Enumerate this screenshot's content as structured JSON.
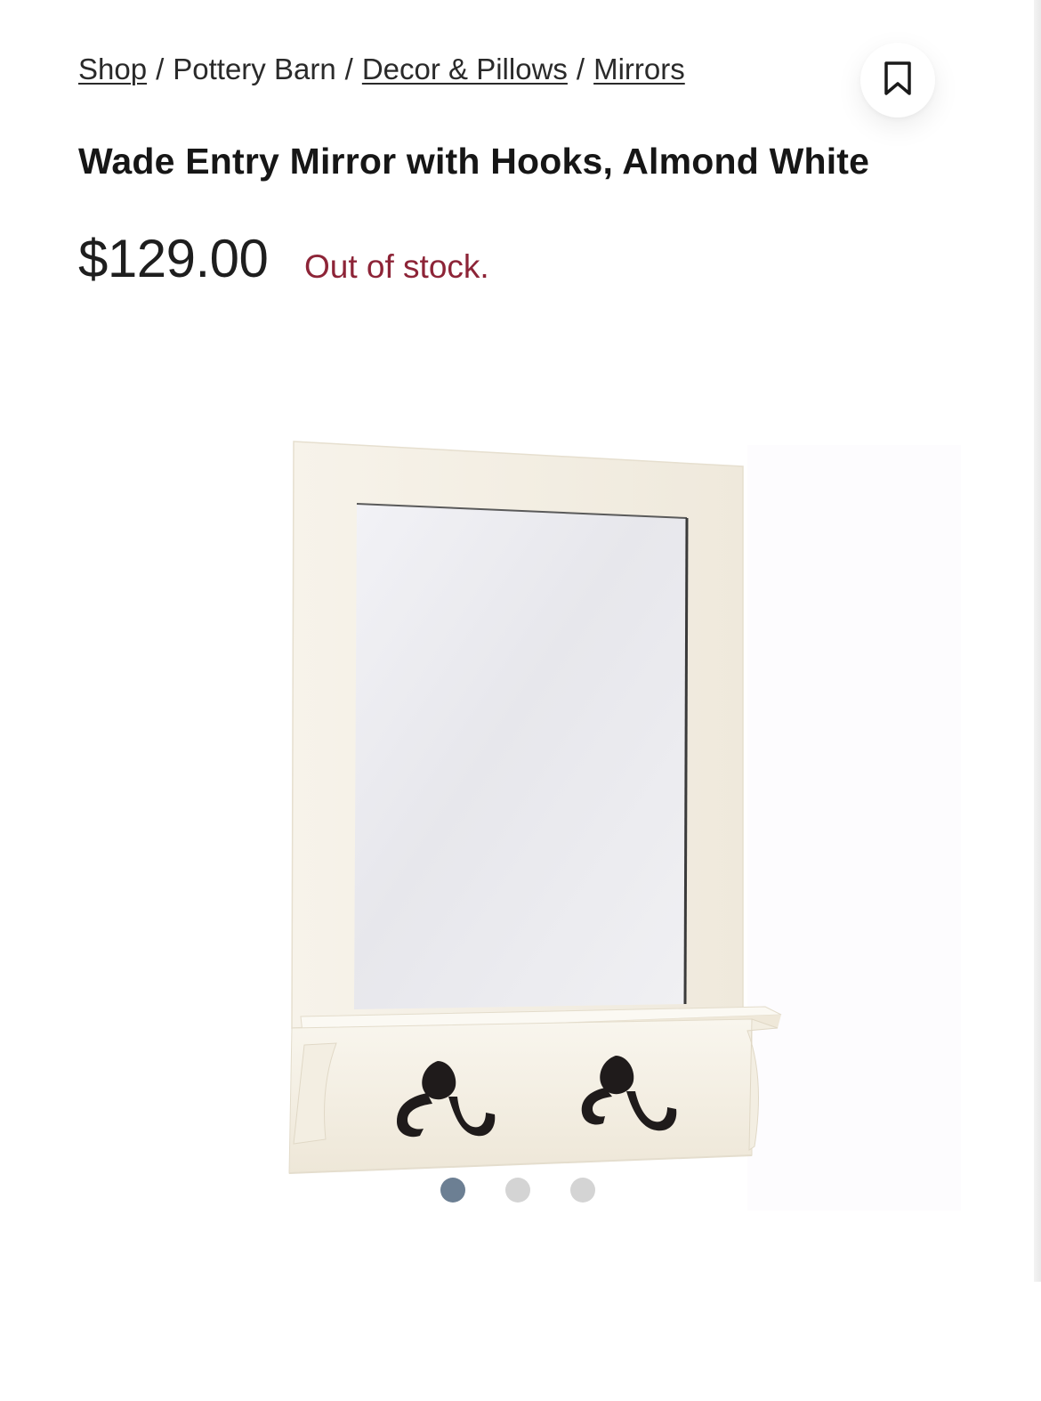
{
  "breadcrumb": {
    "items": [
      {
        "label": "Shop",
        "link": true
      },
      {
        "label": "Pottery Barn",
        "link": false
      },
      {
        "label": "Decor & Pillows",
        "link": true
      },
      {
        "label": "Mirrors",
        "link": true
      }
    ],
    "separator": "/"
  },
  "bookmark": {
    "icon": "bookmark-icon"
  },
  "product": {
    "title": "Wade Entry Mirror with Hooks, Almond White",
    "price": "$129.00",
    "stock_status": "Out of stock."
  },
  "gallery": {
    "image_count": 3,
    "active_index": 0,
    "image_subject": "mirror-with-hooks"
  },
  "colors": {
    "stock_red": "#8d2437",
    "dot_active": "#6c7f93",
    "dot_inactive": "#d4d4d4",
    "frame": "#f6f1e6"
  }
}
